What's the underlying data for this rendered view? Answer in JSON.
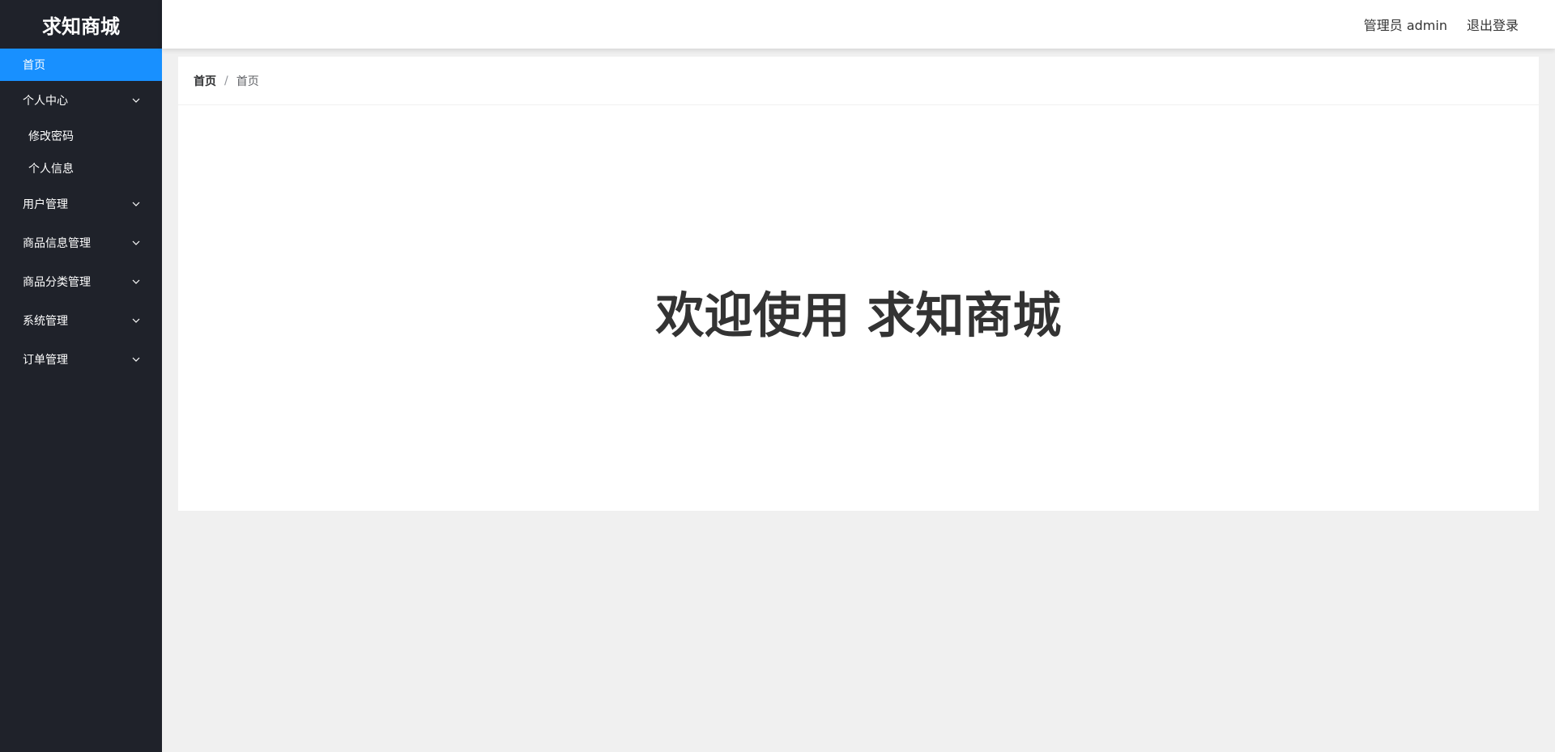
{
  "app": {
    "title": "求知商城"
  },
  "sidebar": {
    "home": "首页",
    "groups": [
      {
        "label": "个人中心",
        "children": [
          "修改密码",
          "个人信息"
        ]
      },
      {
        "label": "用户管理"
      },
      {
        "label": "商品信息管理"
      },
      {
        "label": "商品分类管理"
      },
      {
        "label": "系统管理"
      },
      {
        "label": "订单管理"
      }
    ]
  },
  "header": {
    "user": "管理员 admin",
    "logout": "退出登录"
  },
  "breadcrumb": [
    "首页",
    "首页"
  ],
  "main": {
    "welcome": "欢迎使用 求知商城"
  },
  "colors": {
    "sidebar_bg": "#1f222a",
    "active_bg": "#1890ff",
    "page_bg": "#f0f0f0"
  }
}
